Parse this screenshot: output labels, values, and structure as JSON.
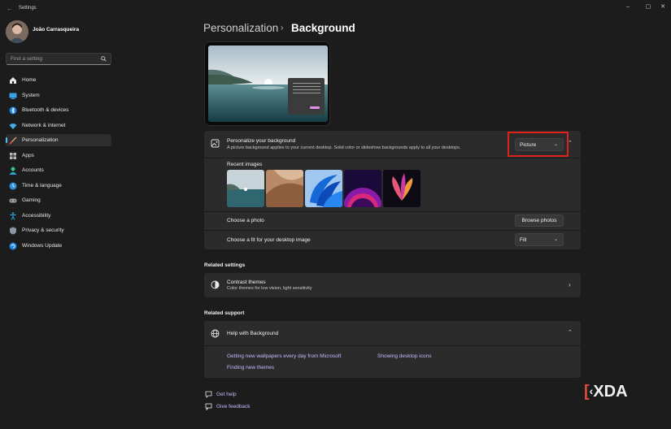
{
  "window": {
    "title": "Settings",
    "controls": [
      "minimize-icon",
      "maximize-icon",
      "close-icon"
    ]
  },
  "user": {
    "name": "João Carrasqueira"
  },
  "search": {
    "placeholder": "Find a setting"
  },
  "nav": {
    "items": [
      {
        "label": "Home",
        "icon": "home-icon"
      },
      {
        "label": "System",
        "icon": "system-icon"
      },
      {
        "label": "Bluetooth & devices",
        "icon": "bluetooth-icon"
      },
      {
        "label": "Network & internet",
        "icon": "wifi-icon"
      },
      {
        "label": "Personalization",
        "icon": "brush-icon",
        "active": true
      },
      {
        "label": "Apps",
        "icon": "apps-icon"
      },
      {
        "label": "Accounts",
        "icon": "accounts-icon"
      },
      {
        "label": "Time & language",
        "icon": "time-language-icon"
      },
      {
        "label": "Gaming",
        "icon": "gaming-icon"
      },
      {
        "label": "Accessibility",
        "icon": "accessibility-icon"
      },
      {
        "label": "Privacy & security",
        "icon": "shield-icon"
      },
      {
        "label": "Windows Update",
        "icon": "update-icon"
      }
    ]
  },
  "header": {
    "parent": "Personalization",
    "separator": "›",
    "current": "Background"
  },
  "personalize": {
    "title": "Personalize your background",
    "description": "A picture background applies to your current desktop. Solid color or slideshow backgrounds apply to all your desktops.",
    "dropdown_value": "Picture",
    "recent_label": "Recent images",
    "choose_photo_label": "Choose a photo",
    "browse_button": "Browse photos",
    "fit_label": "Choose a fit for your desktop image",
    "fit_value": "Fill"
  },
  "related_settings": {
    "heading": "Related settings",
    "contrast_title": "Contrast themes",
    "contrast_desc": "Color themes for low vision, light sensitivity"
  },
  "related_support": {
    "heading": "Related support",
    "help_title": "Help with Background",
    "links": [
      "Getting new wallpapers every day from Microsoft",
      "Showing desktop icons",
      "Finding new themes"
    ]
  },
  "footer": {
    "get_help": "Get help",
    "feedback": "Give feedback"
  },
  "watermark": "XDA",
  "colors": {
    "accent": "#4cc2ff",
    "link": "#c9b6ff",
    "highlight_box": "#e0201b",
    "background": "#1c1c1c",
    "card": "#2b2b2b"
  }
}
